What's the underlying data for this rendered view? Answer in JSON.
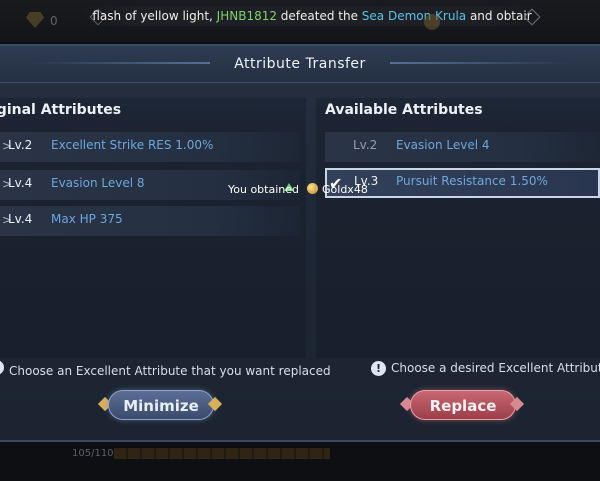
{
  "hud": {
    "gem_value": "0",
    "hp_text": "105/110",
    "ticker": {
      "part1": "flash of yellow light, ",
      "player": "JHNB1812",
      "part2": " defeated the ",
      "monster": "Sea Demon Krula",
      "part3": " and obtair"
    }
  },
  "dialog": {
    "title": "Attribute Transfer",
    "left": {
      "heading": "iginal Attributes",
      "rows": [
        {
          "level": "Lv.2",
          "name": "Excellent Strike RES 1.00%"
        },
        {
          "level": "Lv.4",
          "name": "Evasion Level 8"
        },
        {
          "level": "Lv.4",
          "name": "Max HP 375"
        }
      ],
      "hint": "Choose an Excellent Attribute that you want replaced"
    },
    "right": {
      "heading": "Available Attributes",
      "rows": [
        {
          "level": "Lv.2",
          "name": "Evasion Level 4"
        },
        {
          "level": "Lv.3",
          "name": "Pursuit Resistance 1.50%"
        }
      ],
      "hint": "Choose a desired Excellent Attributes"
    },
    "toast": {
      "text": "You obtained",
      "item": "Goldx48"
    },
    "buttons": {
      "minimize": "Minimize",
      "replace": "Replace"
    },
    "icons": {
      "info": "!",
      "check": "✔",
      "chevron": ">"
    }
  },
  "colors": {
    "attribute_text": "#6fa6dc",
    "minimize_button": "#4b5d82",
    "replace_button": "#b4505c"
  }
}
